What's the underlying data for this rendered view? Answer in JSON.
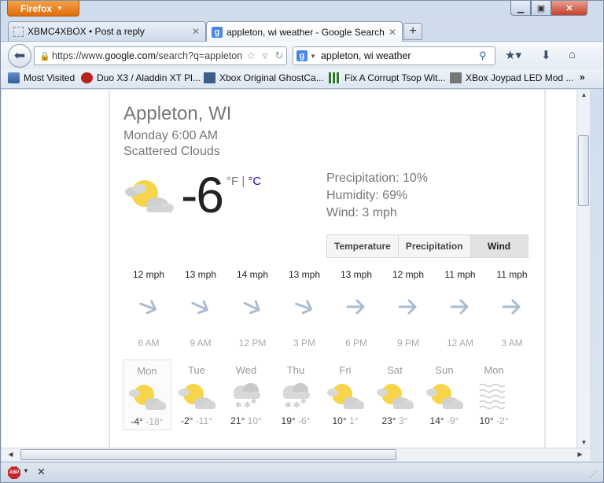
{
  "app": {
    "menu_label": "Firefox"
  },
  "tabs": [
    {
      "title": "XBMC4XBOX • Post a reply",
      "active": false
    },
    {
      "title": "appleton, wi weather - Google Search",
      "active": true
    }
  ],
  "navbar": {
    "url_prefix": "https://www.",
    "url_host": "google.com",
    "url_rest": "/search?q=appleton",
    "search_engine_icon": "g-icon",
    "search_text": "appleton, wi weather"
  },
  "bookmarks": [
    {
      "label": "Most Visited",
      "icon": "bookmarks-folder-icon"
    },
    {
      "label": "Duo X3 / Aladdin XT Pl...",
      "icon": "site-favicon"
    },
    {
      "label": "Xbox Original GhostCa...",
      "icon": "site-favicon"
    },
    {
      "label": "Fix A Corrupt Tsop Wit...",
      "icon": "site-favicon"
    },
    {
      "label": "XBox Joypad LED Mod ...",
      "icon": "site-favicon"
    }
  ],
  "weather": {
    "location": "Appleton, WI",
    "datetime": "Monday 6:00 AM",
    "condition": "Scattered Clouds",
    "temp": "-6",
    "unit_f": "°F",
    "unit_sep": " | ",
    "unit_c": "°C",
    "precipitation": "Precipitation: 10%",
    "humidity": "Humidity: 69%",
    "wind": "Wind: 3 mph",
    "view_buttons": [
      "Temperature",
      "Precipitation",
      "Wind"
    ],
    "selected_view": "Wind",
    "hourly": [
      {
        "speed": "12 mph",
        "time": "6 AM",
        "dir": 20
      },
      {
        "speed": "13 mph",
        "time": "9 AM",
        "dir": 25
      },
      {
        "speed": "14 mph",
        "time": "12 PM",
        "dir": 25
      },
      {
        "speed": "13 mph",
        "time": "3 PM",
        "dir": 20
      },
      {
        "speed": "13 mph",
        "time": "6 PM",
        "dir": 0
      },
      {
        "speed": "12 mph",
        "time": "9 PM",
        "dir": 0
      },
      {
        "speed": "11 mph",
        "time": "12 AM",
        "dir": 0
      },
      {
        "speed": "11 mph",
        "time": "3 AM",
        "dir": 0
      }
    ],
    "daily": [
      {
        "day": "Mon",
        "hi": "-4°",
        "lo": "-18°",
        "icon": "partly-cloudy-icon",
        "selected": true
      },
      {
        "day": "Tue",
        "hi": "-2°",
        "lo": "-11°",
        "icon": "partly-cloudy-icon"
      },
      {
        "day": "Wed",
        "hi": "21°",
        "lo": "10°",
        "icon": "snow-cloud-icon"
      },
      {
        "day": "Thu",
        "hi": "19°",
        "lo": "-6°",
        "icon": "snow-cloud-icon"
      },
      {
        "day": "Fri",
        "hi": "10°",
        "lo": "1°",
        "icon": "partly-cloudy-icon"
      },
      {
        "day": "Sat",
        "hi": "23°",
        "lo": "3°",
        "icon": "partly-cloudy-icon"
      },
      {
        "day": "Sun",
        "hi": "14°",
        "lo": "-9°",
        "icon": "partly-cloudy-icon"
      },
      {
        "day": "Mon",
        "hi": "10°",
        "lo": "-2°",
        "icon": "fog-icon"
      }
    ]
  },
  "colors": {
    "sun": "#f7d54a",
    "cloud": "#d8d8d8",
    "arrow": "#a9bcd0",
    "accent": "#1a0dab"
  }
}
